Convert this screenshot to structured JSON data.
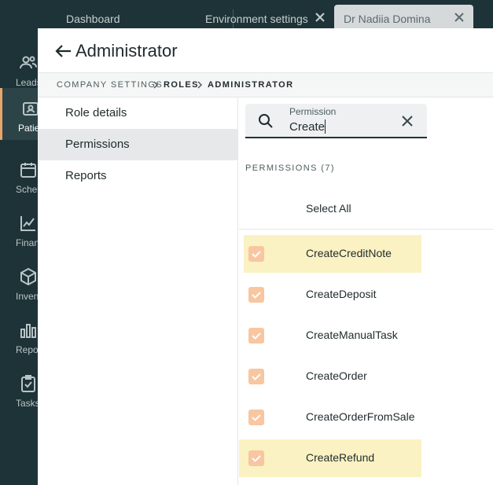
{
  "sidebar": {
    "items": [
      {
        "label": "Leads",
        "icon": "people-icon",
        "active": false
      },
      {
        "label": "Patients",
        "icon": "id-card-icon",
        "active": true
      },
      {
        "label": "Schedule",
        "icon": "calendar-icon",
        "active": false
      },
      {
        "label": "Finance",
        "icon": "chart-icon",
        "active": false
      },
      {
        "label": "Inventory",
        "icon": "box-icon",
        "active": false
      },
      {
        "label": "Reports",
        "icon": "bar-chart-icon",
        "active": false
      },
      {
        "label": "Tasks",
        "icon": "clipboard-check-icon",
        "active": false
      }
    ]
  },
  "tabs": [
    {
      "label": "Dashboard"
    },
    {
      "label": "Environment settings"
    },
    {
      "label": "Dr Nadiia Domina"
    }
  ],
  "panel": {
    "title": "Administrator",
    "breadcrumb": [
      "COMPANY SETTINGS",
      "ROLES",
      "ADMINISTRATOR"
    ]
  },
  "menu": {
    "items": [
      "Role details",
      "Permissions",
      "Reports"
    ],
    "active": "Permissions"
  },
  "search": {
    "label": "Permission",
    "value": "Create"
  },
  "permissions": {
    "heading": "PERMISSIONS (7)",
    "select_all": "Select All",
    "items": [
      {
        "label": "CreateCreditNote",
        "checked": true,
        "highlighted": true
      },
      {
        "label": "CreateDeposit",
        "checked": true,
        "highlighted": false
      },
      {
        "label": "CreateManualTask",
        "checked": true,
        "highlighted": false
      },
      {
        "label": "CreateOrder",
        "checked": true,
        "highlighted": false
      },
      {
        "label": "CreateOrderFromSale",
        "checked": true,
        "highlighted": false
      },
      {
        "label": "CreateRefund",
        "checked": true,
        "highlighted": true
      }
    ]
  },
  "colors": {
    "sidebar_bg": "#1e3337",
    "accent": "#e9a56b",
    "checkbox": "#f8c6a0",
    "highlight": "#fbf2c3"
  }
}
